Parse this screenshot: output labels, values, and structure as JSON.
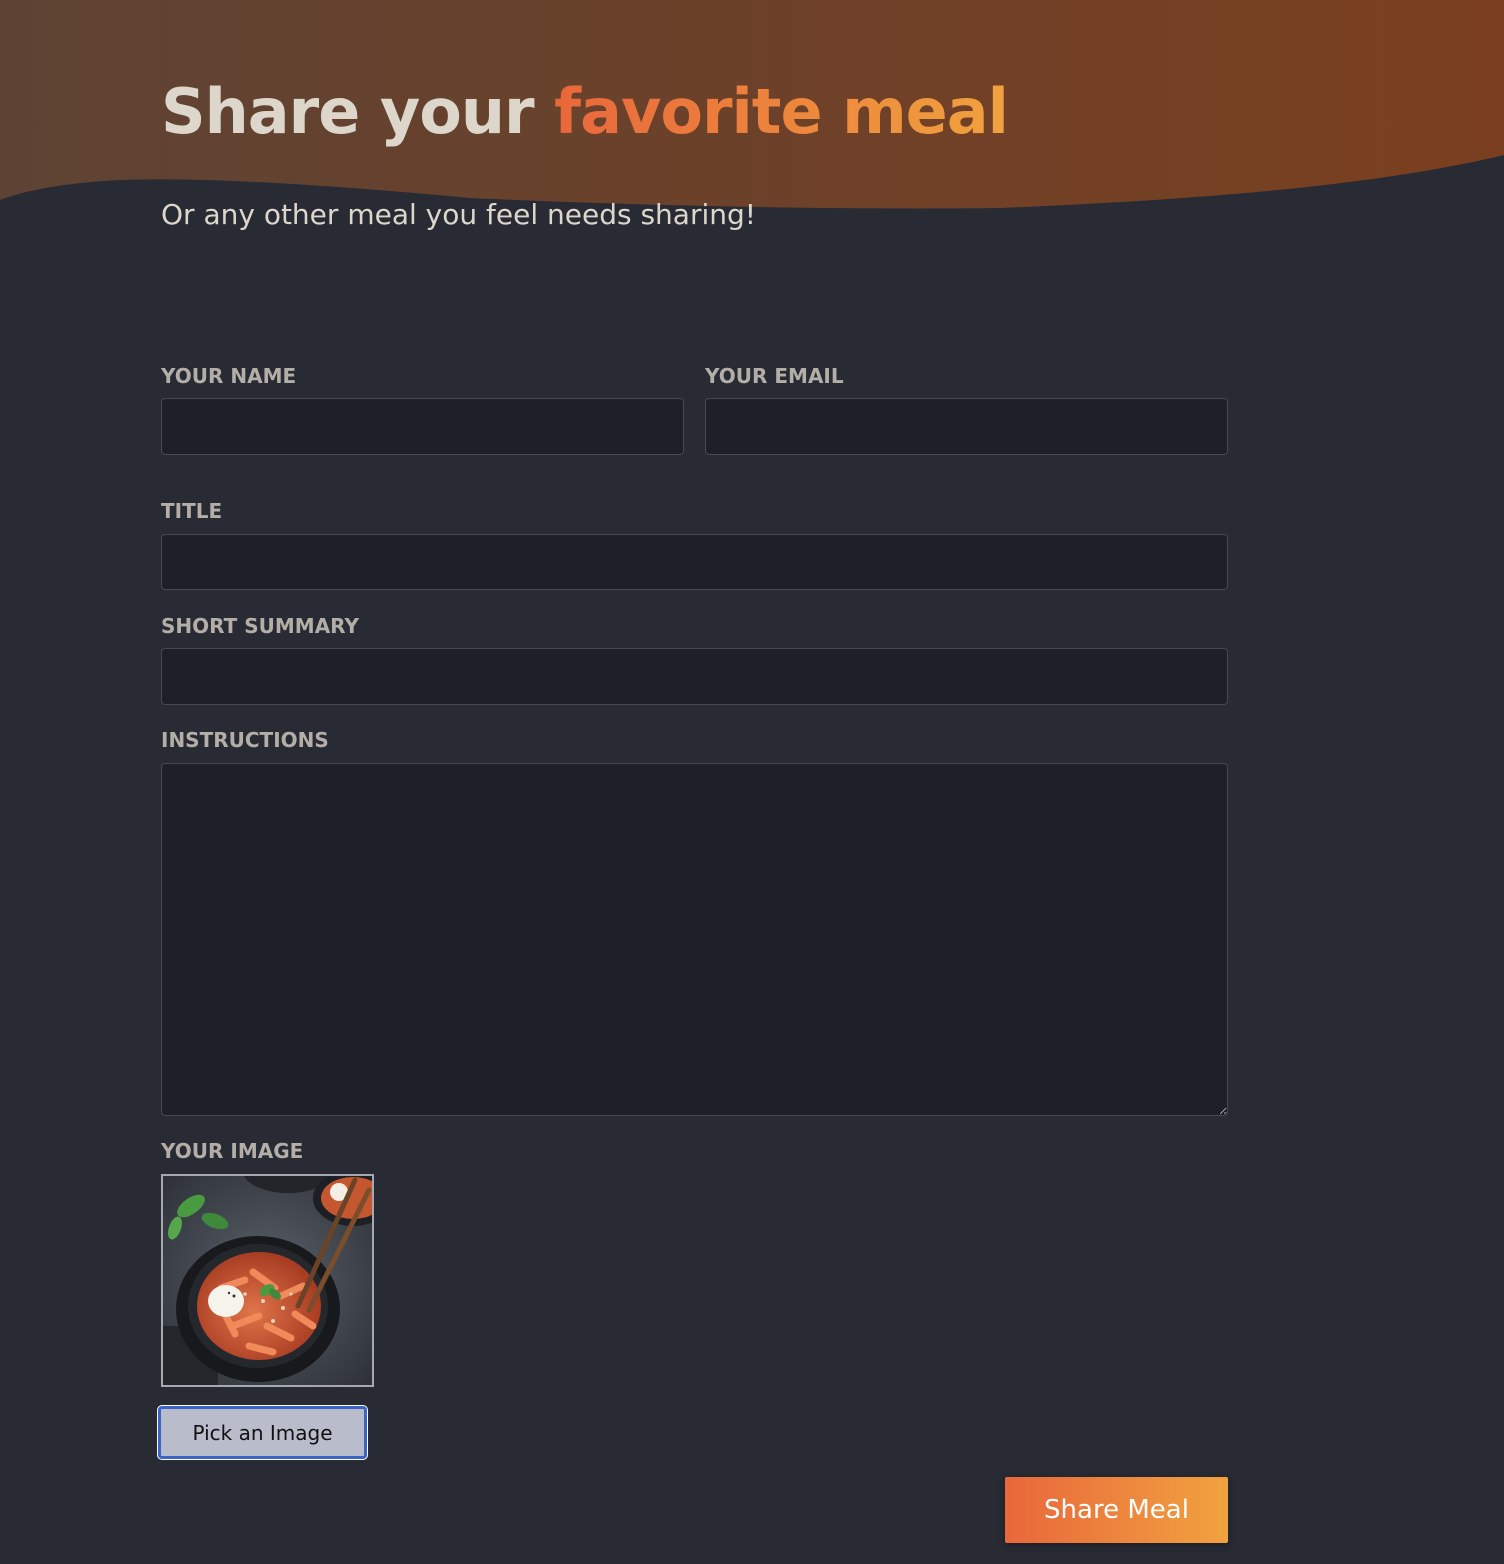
{
  "header": {
    "title_plain": "Share your ",
    "title_accent": "favorite meal",
    "subtitle": "Or any other meal you feel needs sharing!"
  },
  "form": {
    "name": {
      "label": "Your Name",
      "value": "",
      "placeholder": ""
    },
    "email": {
      "label": "Your Email",
      "value": "",
      "placeholder": ""
    },
    "title": {
      "label": "Title",
      "value": "",
      "placeholder": ""
    },
    "summary": {
      "label": "Short Summary",
      "value": "",
      "placeholder": ""
    },
    "instructions": {
      "label": "Instructions",
      "value": "",
      "placeholder": ""
    },
    "image": {
      "label": "Your Image",
      "picked_image": "pasta-bowl-photo",
      "pick_button_label": "Pick an Image"
    },
    "submit_label": "Share Meal"
  },
  "colors": {
    "background": "#282a34",
    "header_gradient_start": "#5e4334",
    "header_gradient_end": "#7b3f1f",
    "accent_start": "#e9673b",
    "accent_end": "#f0a23f",
    "label_text": "#b3aea6",
    "field_background": "#1e2029",
    "pick_button_background": "#b9bccb",
    "pick_button_focus_border": "#3c64c8"
  }
}
